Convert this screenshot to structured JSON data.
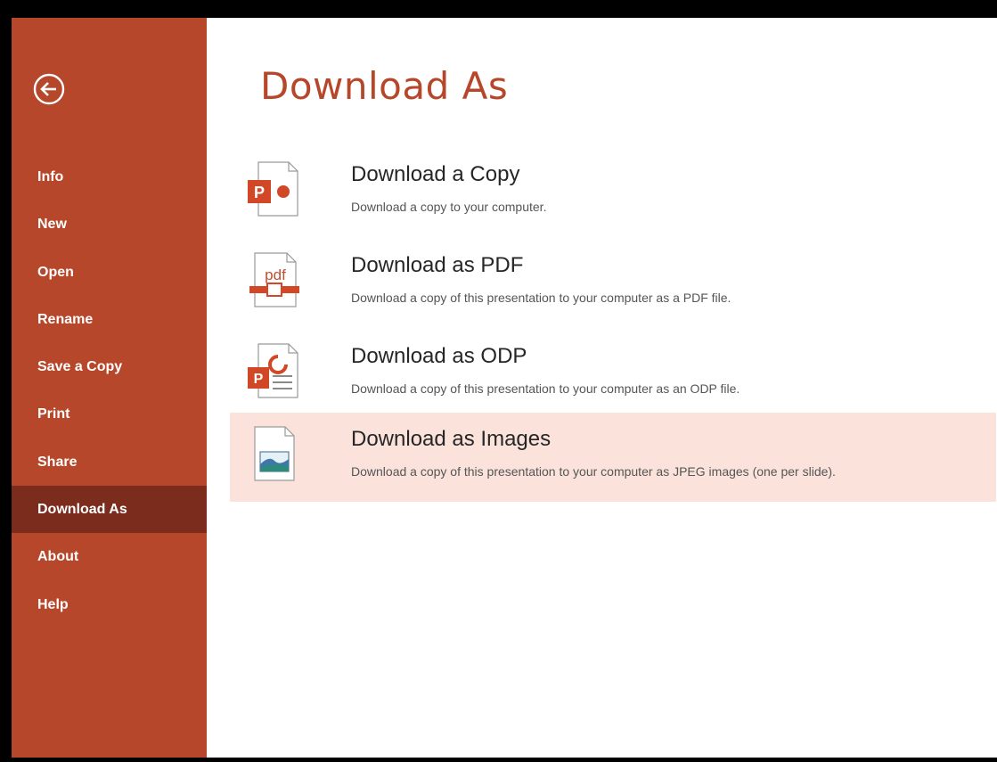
{
  "sidebar": {
    "back_icon": "back-arrow-circle-icon",
    "items": [
      {
        "label": "Info",
        "active": false
      },
      {
        "label": "New",
        "active": false
      },
      {
        "label": "Open",
        "active": false
      },
      {
        "label": "Rename",
        "active": false
      },
      {
        "label": "Save a Copy",
        "active": false
      },
      {
        "label": "Print",
        "active": false
      },
      {
        "label": "Share",
        "active": false
      },
      {
        "label": "Download As",
        "active": true
      },
      {
        "label": "About",
        "active": false
      },
      {
        "label": "Help",
        "active": false
      }
    ]
  },
  "main": {
    "title": "Download As",
    "options": [
      {
        "title": "Download a Copy",
        "description": "Download a copy to your computer.",
        "icon": "powerpoint-file-icon",
        "highlighted": false
      },
      {
        "title": "Download as PDF",
        "description": "Download a copy of this presentation to your computer as a PDF file.",
        "icon": "pdf-file-icon",
        "highlighted": false
      },
      {
        "title": "Download as ODP",
        "description": "Download a copy of this presentation to your computer as an ODP file.",
        "icon": "odp-file-icon",
        "highlighted": false
      },
      {
        "title": "Download as Images",
        "description": "Download a copy of this presentation to your computer as JPEG images (one per slide).",
        "icon": "image-file-icon",
        "highlighted": true
      }
    ]
  },
  "colors": {
    "accent": "#b7472a",
    "sidebar_active": "#7b2c1c",
    "highlight": "#fbe3dc",
    "background": "#ffffff",
    "frame": "#000000"
  }
}
